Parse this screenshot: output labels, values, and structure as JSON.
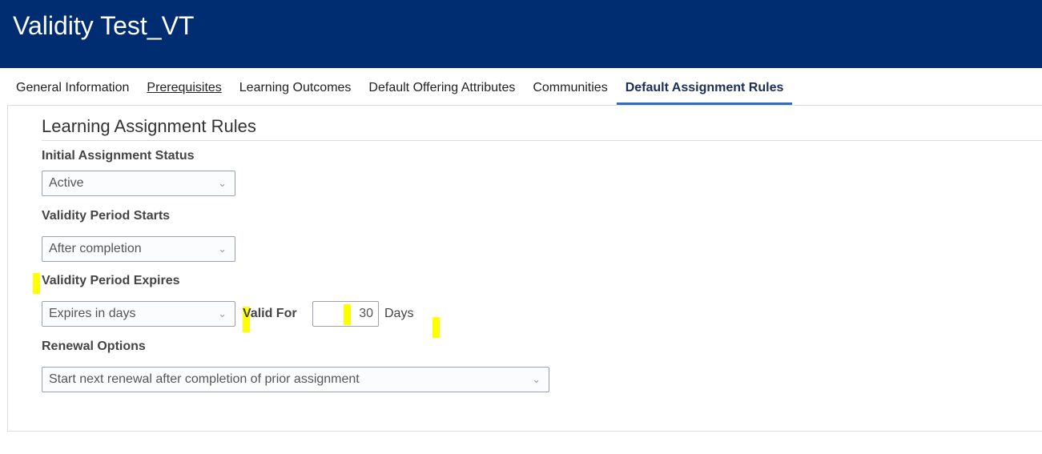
{
  "header": {
    "title": "Validity Test_VT"
  },
  "tabs": [
    {
      "label": "General Information"
    },
    {
      "label": "Prerequisites"
    },
    {
      "label": "Learning Outcomes"
    },
    {
      "label": "Default Offering Attributes"
    },
    {
      "label": "Communities"
    },
    {
      "label": "Default Assignment Rules"
    }
  ],
  "section": {
    "title": "Learning Assignment Rules",
    "initial_status": {
      "label": "Initial Assignment Status",
      "value": "Active"
    },
    "period_starts": {
      "label": "Validity Period Starts",
      "value": "After completion"
    },
    "period_expires": {
      "label": "Validity Period Expires",
      "value": "Expires in days"
    },
    "valid_for": {
      "label": "Valid For",
      "value": "30",
      "unit": "Days"
    },
    "renewal": {
      "label": "Renewal Options",
      "value": "Start next renewal after completion of prior assignment"
    }
  }
}
